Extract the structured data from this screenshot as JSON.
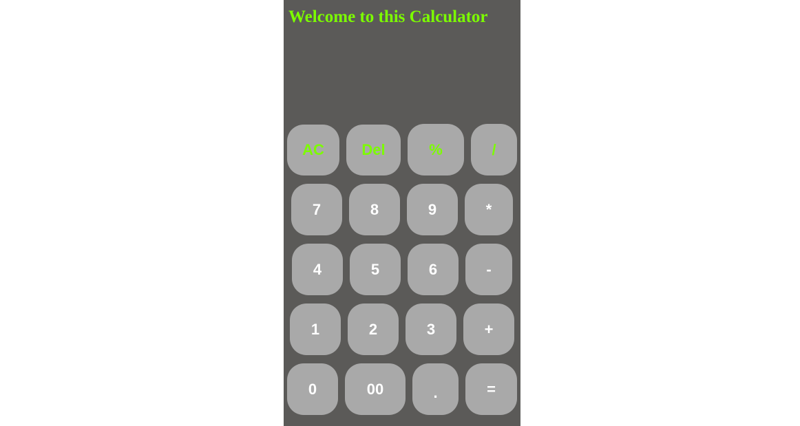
{
  "header": {
    "title": "Welcome to this Calculator"
  },
  "display": {
    "value": ""
  },
  "colors": {
    "panel": "#5b5a58",
    "key": "#a9a9a9",
    "title": "#7cfc00",
    "function_key_text": "#7cfc00",
    "digit_key_text": "#ffffff"
  },
  "keys": {
    "ac": "AC",
    "del": "Del",
    "percent": "%",
    "divide": "/",
    "seven": "7",
    "eight": "8",
    "nine": "9",
    "multiply": "*",
    "four": "4",
    "five": "5",
    "six": "6",
    "minus": "-",
    "one": "1",
    "two": "2",
    "three": "3",
    "plus": "+",
    "zero": "0",
    "double_zero": "00",
    "decimal": ".",
    "equals": "="
  }
}
